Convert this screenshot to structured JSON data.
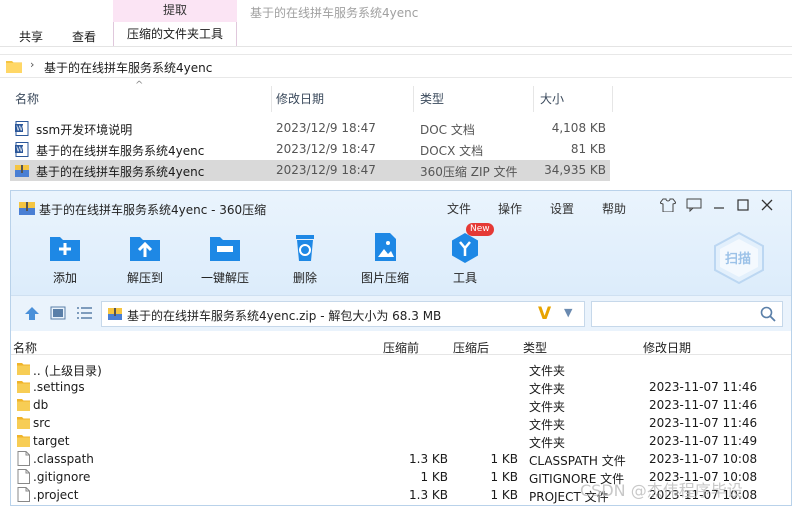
{
  "explorer": {
    "context_tab": "提取",
    "context_subtab": "压缩的文件夹工具",
    "window_title": "基于的在线拼车服务系统4yenc",
    "ribbon_tabs": [
      "共享",
      "查看"
    ],
    "breadcrumb": "基于的在线拼车服务系统4yenc",
    "columns": {
      "name": "名称",
      "date": "修改日期",
      "type": "类型",
      "size": "大小"
    },
    "files": [
      {
        "name": "ssm开发环境说明",
        "date": "2023/12/9 18:47",
        "type": "DOC 文档",
        "size": "4,108 KB",
        "icon": "word-doc-icon"
      },
      {
        "name": "基于的在线拼车服务系统4yenc",
        "date": "2023/12/9 18:47",
        "type": "DOCX 文档",
        "size": "81 KB",
        "icon": "word-docx-icon"
      },
      {
        "name": "基于的在线拼车服务系统4yenc",
        "date": "2023/12/9 18:47",
        "type": "360压缩 ZIP 文件",
        "size": "34,935 KB",
        "icon": "zip-archive-icon"
      }
    ]
  },
  "zip_window": {
    "title": "基于的在线拼车服务系统4yenc - 360压缩",
    "menu": [
      "文件",
      "操作",
      "设置",
      "帮助"
    ],
    "toolbar": [
      {
        "label": "添加",
        "icon": "add-icon"
      },
      {
        "label": "解压到",
        "icon": "extract-to-icon"
      },
      {
        "label": "一键解压",
        "icon": "one-click-extract-icon"
      },
      {
        "label": "删除",
        "icon": "delete-icon"
      },
      {
        "label": "图片压缩",
        "icon": "image-compress-icon"
      },
      {
        "label": "工具",
        "icon": "tools-icon"
      }
    ],
    "new_badge": "New",
    "scan_label": "扫描",
    "path": "基于的在线拼车服务系统4yenc.zip - 解包大小为 68.3 MB",
    "columns": {
      "name": "名称",
      "compressed": "压缩前",
      "packed": "压缩后",
      "type": "类型",
      "date": "修改日期"
    },
    "rows": [
      {
        "name": ".. (上级目录)",
        "compressed": "",
        "packed": "",
        "type": "文件夹",
        "date": "",
        "kind": "folder"
      },
      {
        "name": ".settings",
        "compressed": "",
        "packed": "",
        "type": "文件夹",
        "date": "2023-11-07 11:46",
        "kind": "folder"
      },
      {
        "name": "db",
        "compressed": "",
        "packed": "",
        "type": "文件夹",
        "date": "2023-11-07 11:46",
        "kind": "folder"
      },
      {
        "name": "src",
        "compressed": "",
        "packed": "",
        "type": "文件夹",
        "date": "2023-11-07 11:46",
        "kind": "folder"
      },
      {
        "name": "target",
        "compressed": "",
        "packed": "",
        "type": "文件夹",
        "date": "2023-11-07 11:49",
        "kind": "folder"
      },
      {
        "name": ".classpath",
        "compressed": "1.3 KB",
        "packed": "1 KB",
        "type": "CLASSPATH 文件",
        "date": "2023-11-07 10:08",
        "kind": "file"
      },
      {
        "name": ".gitignore",
        "compressed": "1 KB",
        "packed": "1 KB",
        "type": "GITIGNORE 文件",
        "date": "2023-11-07 10:08",
        "kind": "file"
      },
      {
        "name": ".project",
        "compressed": "1.3 KB",
        "packed": "1 KB",
        "type": "PROJECT 文件",
        "date": "2023-11-07 10:08",
        "kind": "file"
      }
    ]
  },
  "watermark": "CSDN @杰伟程序毕设"
}
